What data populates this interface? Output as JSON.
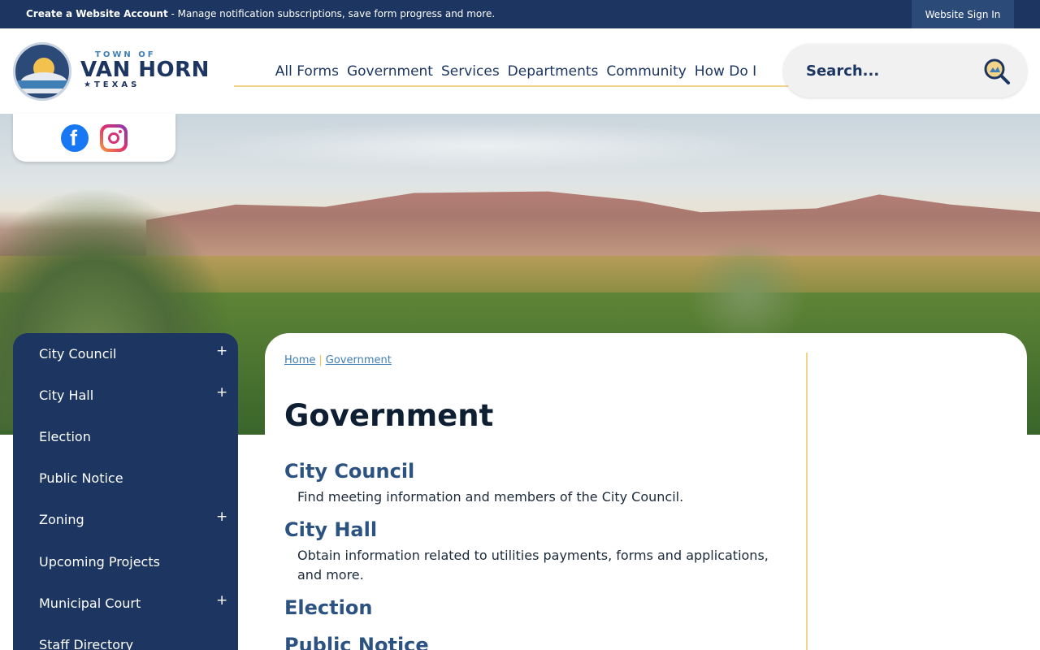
{
  "topbar": {
    "account_link": "Create a Website Account",
    "account_message": " - Manage notification subscriptions, save form progress and more.",
    "sign_in": "Website Sign In"
  },
  "logo": {
    "town_of": "TOWN OF",
    "name": "VAN HORN",
    "state": "★TEXAS"
  },
  "nav": {
    "items": [
      "All Forms",
      "Government",
      "Services",
      "Departments",
      "Community",
      "How Do I"
    ]
  },
  "search": {
    "placeholder": "Search..."
  },
  "social": {
    "facebook_icon": "facebook-icon",
    "instagram_icon": "instagram-icon"
  },
  "sidebar": {
    "items": [
      {
        "label": "City Council",
        "expandable": "+"
      },
      {
        "label": "City Hall",
        "expandable": "+"
      },
      {
        "label": "Election",
        "expandable": ""
      },
      {
        "label": "Public Notice",
        "expandable": ""
      },
      {
        "label": "Zoning",
        "expandable": "+"
      },
      {
        "label": "Upcoming Projects",
        "expandable": ""
      },
      {
        "label": "Municipal Court",
        "expandable": "+"
      },
      {
        "label": "Staff Directory",
        "expandable": ""
      }
    ]
  },
  "breadcrumb": {
    "home": "Home",
    "current": "Government"
  },
  "page": {
    "title": "Government",
    "entries": [
      {
        "title": "City Council",
        "description": "Find meeting information and members of the City Council."
      },
      {
        "title": "City Hall",
        "description": "Obtain information related to utilities payments, forms and applications, and more."
      },
      {
        "title": "Election",
        "description": ""
      },
      {
        "title": "Public Notice",
        "description": ""
      }
    ]
  },
  "colors": {
    "primary": "#1c3661",
    "accent": "#f2d48a",
    "link": "#2c5282"
  }
}
